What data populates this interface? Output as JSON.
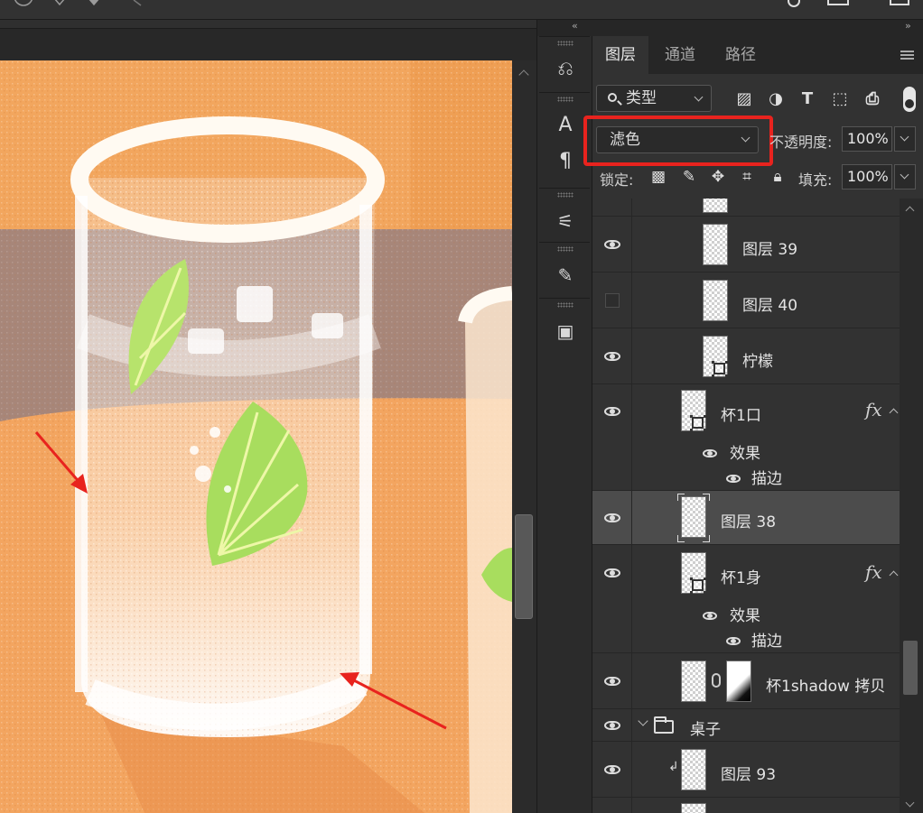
{
  "layers_panel": {
    "tabs": [
      "图层",
      "通道",
      "路径"
    ],
    "active_tab": 0,
    "filter": {
      "value": "类型"
    },
    "filter_icons": [
      "image-filter-icon",
      "adjustment-filter-icon",
      "type-filter-icon",
      "shape-filter-icon",
      "smart-object-filter-icon"
    ],
    "blend_mode": "滤色",
    "opacity_label": "不透明度:",
    "opacity_value": "100%",
    "lock_label": "锁定:",
    "fill_label": "填充:",
    "fill_value": "100%",
    "layers": {
      "l39": "图层 39",
      "l40": "图层 40",
      "lemon": "柠檬",
      "cup_mouth": "杯1口",
      "effects1": "效果",
      "stroke1": "描边",
      "l38": "图层 38",
      "cup_body": "杯1身",
      "effects2": "效果",
      "stroke2": "描边",
      "shadow_copy": "杯1shadow 拷贝",
      "table_group": "桌子",
      "l93": "图层 93",
      "fx": "fx"
    }
  },
  "colors": {
    "highlight": "#e8231e",
    "annotation_arrow": "#e8231e",
    "canvas_bg": "#f2a45f"
  }
}
